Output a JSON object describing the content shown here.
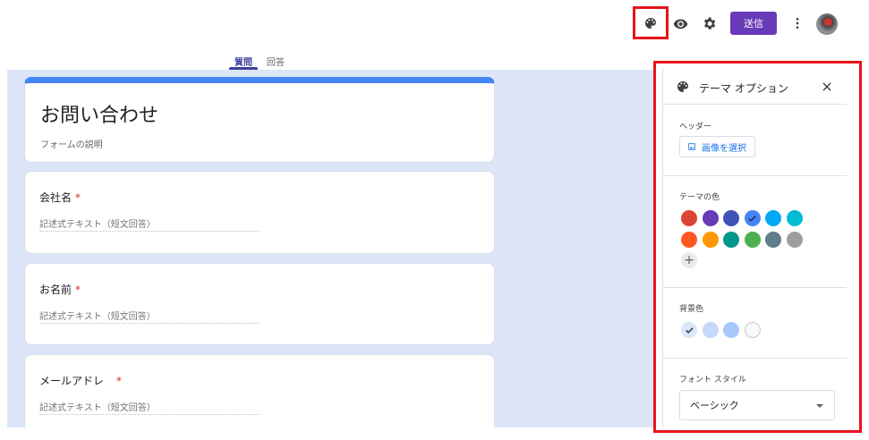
{
  "toolbar": {
    "send_label": "送信",
    "icons": [
      "palette-icon",
      "eye-icon",
      "settings-icon",
      "more-vert-icon"
    ],
    "accent_color": "#673ab7",
    "highlight_color": "#e8141c"
  },
  "tabs": [
    {
      "label": "質問",
      "active": true
    },
    {
      "label": "回答",
      "active": false
    }
  ],
  "form": {
    "title": "お問い合わせ",
    "description": "フォームの説明",
    "questions": [
      {
        "label": "会社名",
        "required_mark": "*",
        "placeholder": "記述式テキスト（短文回答）"
      },
      {
        "label": "お名前",
        "required_mark": "*",
        "placeholder": "記述式テキスト（短文回答）"
      },
      {
        "label": "メールアドレ",
        "required_mark": "*",
        "placeholder": "記述式テキスト（短文回答）"
      }
    ]
  },
  "theme_panel": {
    "title": "テーマ オプション",
    "header_label": "ヘッダー",
    "select_image_label": "画像を選択",
    "theme_color_label": "テーマの色",
    "theme_colors": [
      "#db4437",
      "#673ab7",
      "#3f51b5",
      "#4285f4",
      "#03a9f4",
      "#00bcd4",
      "#ff5722",
      "#ff9800",
      "#009688",
      "#4caf50",
      "#607d8b",
      "#9e9e9e"
    ],
    "selected_theme_color": "#4285f4",
    "background_label": "背景色",
    "background_colors": [
      "#dce6f8",
      "#c6d8fa",
      "#a8c7fa",
      "#f8f9fa"
    ],
    "selected_background_color": "#dce6f8",
    "font_style_label": "フォント スタイル",
    "font_style_value": "ベーシック"
  }
}
